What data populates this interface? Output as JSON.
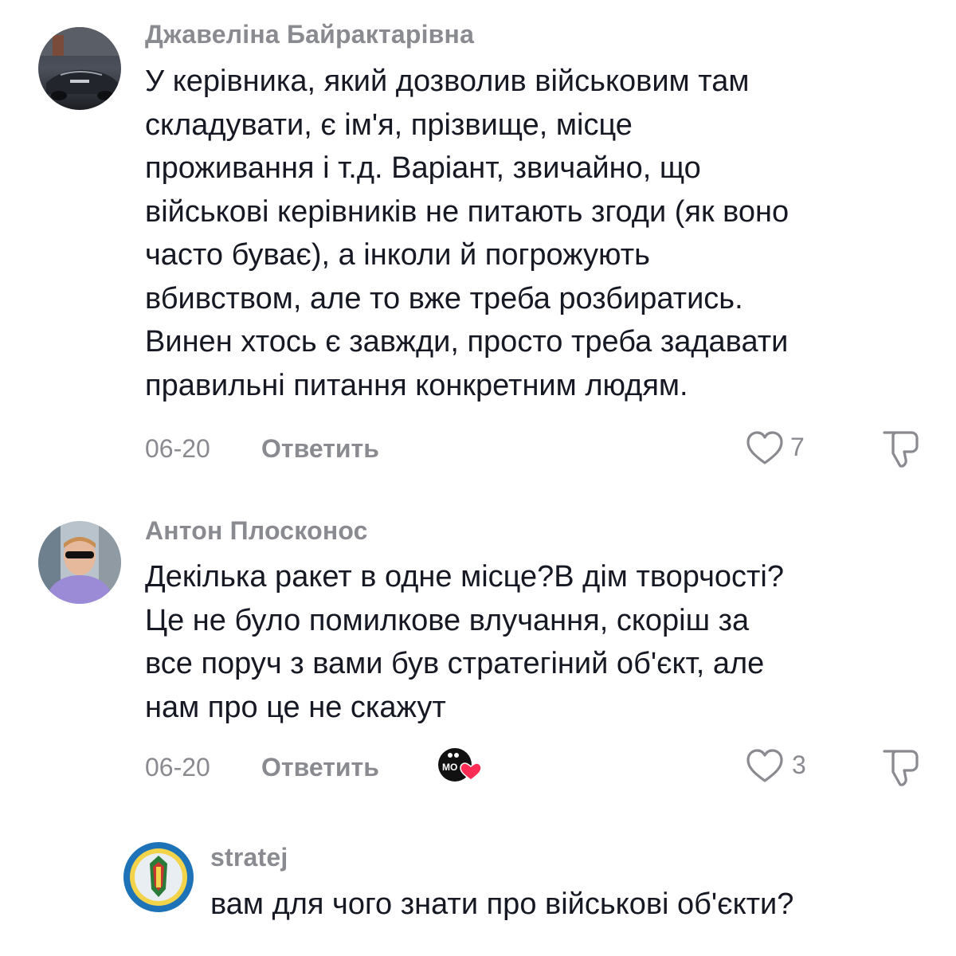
{
  "comments": [
    {
      "username": "Джавеліна Байрактарівна",
      "lines": [
        "У керівника, який дозволив військовим там",
        "складувати, є ім'я, прізвище, місце",
        "проживання і т.д. Варіант, звичайно, що",
        "військові керівників не питають згоди (як воно",
        "часто буває), а інколи й погрожують",
        "вбивством, але то вже треба розбиратись.",
        "Винен хтось є завжди, просто треба задавати",
        "правильні питання конкретним людям."
      ],
      "date": "06-20",
      "reply_label": "Ответить",
      "likes": "7"
    },
    {
      "username": "Антон Плосконос",
      "lines": [
        "Декілька ракет в одне місце?В дім творчості?",
        "Це не було помилкове влучання, скоріш за",
        "все поруч з вами був стратегіний об'єкт, але",
        "нам про це не скажут"
      ],
      "date": "06-20",
      "reply_label": "Ответить",
      "likes": "3",
      "creator_badge_text": "MO"
    },
    {
      "username": "stratej",
      "lines": [
        "вам для чого знати про військові об'єкти?"
      ]
    }
  ],
  "colors": {
    "text": "#161823",
    "muted": "#8a8b91",
    "heart_badge": "#fe2c55"
  },
  "icons": {
    "like": "heart-outline-icon",
    "dislike": "thumbs-down-outline-icon"
  }
}
